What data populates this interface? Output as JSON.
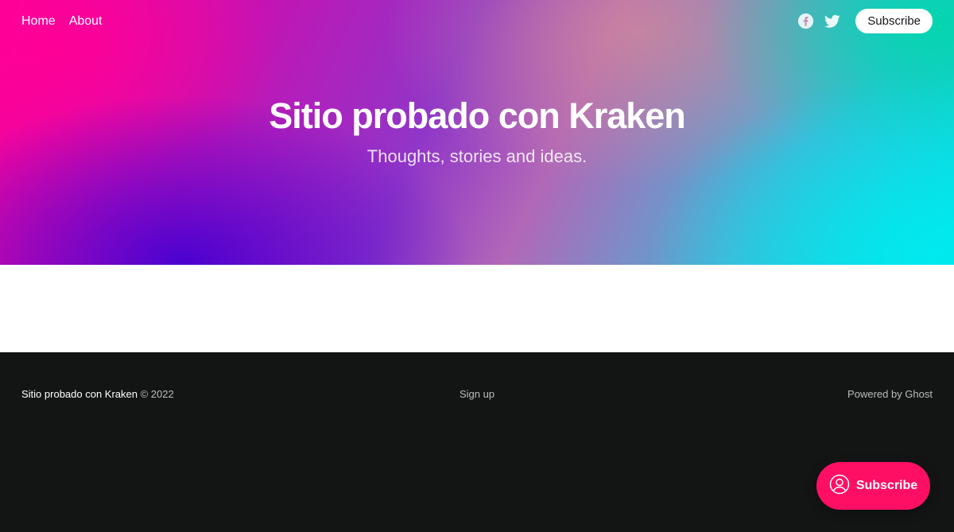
{
  "nav": {
    "links": [
      {
        "label": "Home"
      },
      {
        "label": "About"
      }
    ],
    "social": [
      {
        "icon": "facebook-icon"
      },
      {
        "icon": "twitter-icon"
      }
    ],
    "subscribe_label": "Subscribe"
  },
  "hero": {
    "title": "Sitio probado con Kraken",
    "description": "Thoughts, stories and ideas."
  },
  "footer": {
    "site_name": "Sitio probado con Kraken",
    "copyright": "© 2022",
    "signup_label": "Sign up",
    "powered_by": "Powered by Ghost"
  },
  "portal": {
    "label": "Subscribe",
    "icon": "user-circle-icon",
    "color": "#ff0f64"
  }
}
